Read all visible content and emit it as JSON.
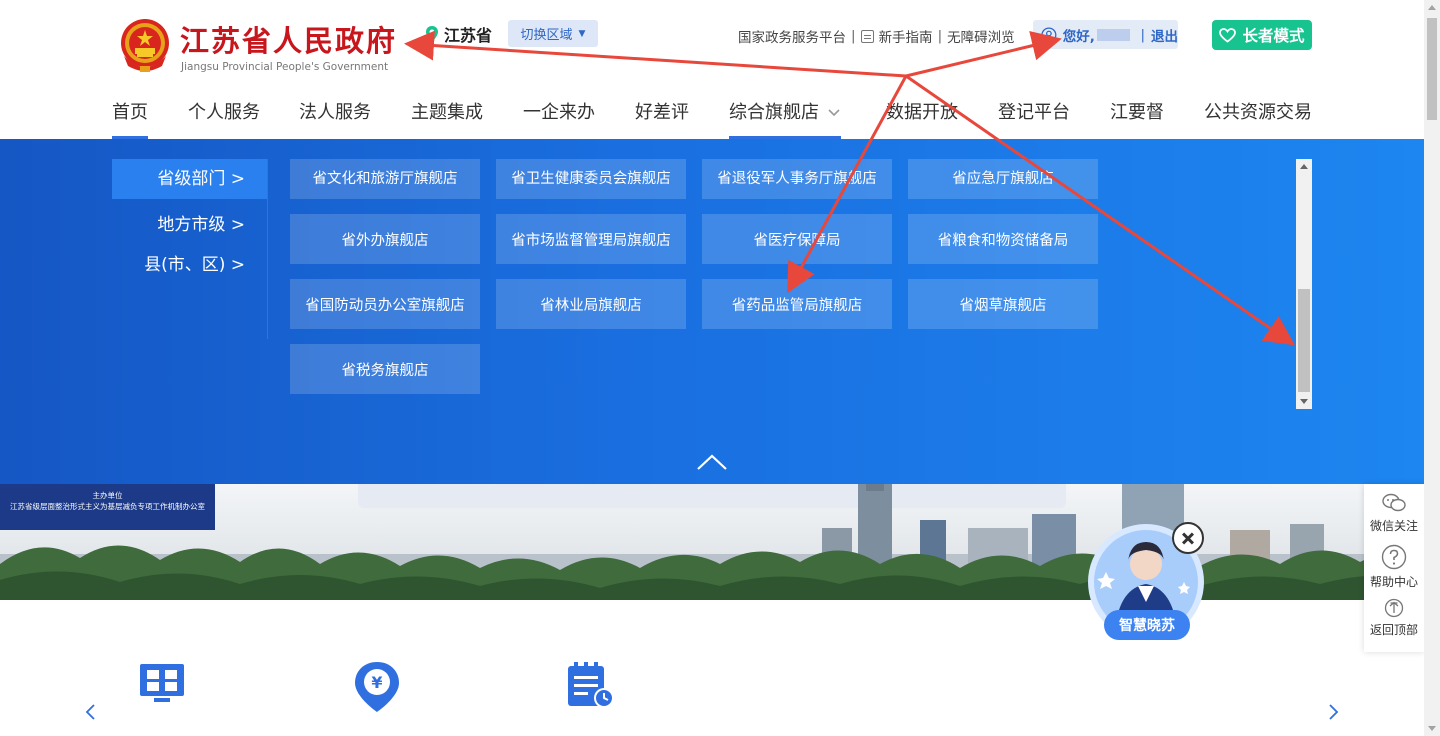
{
  "colors": {
    "accent": "#2f6fe0",
    "title_red": "#c8161d",
    "elder_green": "#17c38f",
    "annotation_red": "#e8473b"
  },
  "header": {
    "title": "江苏省人民政府",
    "subtitle": "Jiangsu Provincial People's Government",
    "region": "江苏省",
    "switch_label": "切换区域",
    "links": {
      "national": "国家政务服务平台",
      "guide": "新手指南",
      "accessible": "无障碍浏览"
    },
    "user": {
      "greeting": "您好,",
      "logout": "退出"
    },
    "elder_mode": "长者模式"
  },
  "nav": {
    "items": [
      "首页",
      "个人服务",
      "法人服务",
      "主题集成",
      "一企来办",
      "好差评",
      "综合旗舰店",
      "数据开放",
      "登记平台",
      "江要督",
      "公共资源交易"
    ]
  },
  "panel": {
    "categories": [
      "省级部门 >",
      "地方市级 >",
      "县(市、区) >"
    ],
    "stores": [
      "省文化和旅游厅旗舰店",
      "省卫生健康委员会旗舰店",
      "省退役军人事务厅旗舰店",
      "省应急厅旗舰店",
      "省外办旗舰店",
      "省市场监督管理局旗舰店",
      "省医疗保障局",
      "省粮食和物资储备局",
      "省国防动员办公室旗舰店",
      "省林业局旗舰店",
      "省药品监管局旗舰店",
      "省烟草旗舰店",
      "省税务旗舰店"
    ]
  },
  "banner": {
    "sponsor_line1": "主办单位",
    "sponsor_line2": "江苏省级层面整治形式主义为基层减负专项工作机制办公室"
  },
  "side_panel": {
    "wechat": "微信关注",
    "help": "帮助中心",
    "top": "返回顶部"
  },
  "assistant": {
    "label": "智慧晓苏"
  }
}
